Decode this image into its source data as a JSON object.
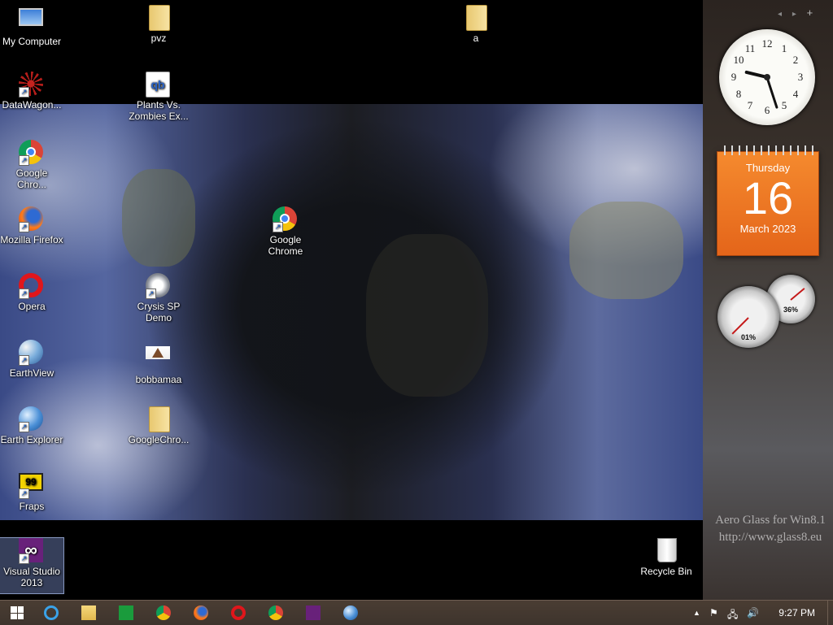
{
  "desktop": {
    "icons": [
      {
        "label": "My Computer"
      },
      {
        "label": "pvz"
      },
      {
        "label": "a"
      },
      {
        "label": "DataWagon..."
      },
      {
        "label": "Plants Vs. Zombies Ex..."
      },
      {
        "label": "Google Chro..."
      },
      {
        "label": "Mozilla Firefox"
      },
      {
        "label": "Google Chrome"
      },
      {
        "label": "Opera"
      },
      {
        "label": "Crysis SP Demo"
      },
      {
        "label": "EarthView"
      },
      {
        "label": "bobbamaa"
      },
      {
        "label": "Earth Explorer"
      },
      {
        "label": "GoogleChro..."
      },
      {
        "label": "Fraps"
      },
      {
        "label": "Visual Studio 2013"
      },
      {
        "label": "Recycle Bin"
      }
    ]
  },
  "gadgets": {
    "clock": {
      "time": "9:27",
      "numbers": [
        "12",
        "1",
        "2",
        "3",
        "4",
        "5",
        "6",
        "7",
        "8",
        "9",
        "10",
        "11"
      ]
    },
    "calendar": {
      "day_of_week": "Thursday",
      "day": "16",
      "month_year": "March 2023"
    },
    "cpu_meter": {
      "cpu": "01%",
      "memory": "36%"
    },
    "toolbar": {
      "prev": "◂",
      "next": "▸",
      "add": "+"
    }
  },
  "watermark": {
    "line1": "Aero Glass for Win8.1",
    "line2": "http://www.glass8.eu"
  },
  "taskbar": {
    "items": [
      "start-icon",
      "internet-explorer-icon",
      "file-explorer-icon",
      "store-icon",
      "chrome-icon",
      "firefox-icon",
      "opera-icon",
      "chrome-icon",
      "visual-studio-icon",
      "earth-explorer-icon"
    ],
    "tray": {
      "overflow": "▲",
      "flag": "⚑",
      "network": "🖧",
      "volume": "🔊"
    },
    "time": "9:27 PM"
  },
  "colors": {
    "calendar_orange": "#f2741f",
    "taskbar": "#43372f",
    "vs_purple": "#68217a"
  }
}
